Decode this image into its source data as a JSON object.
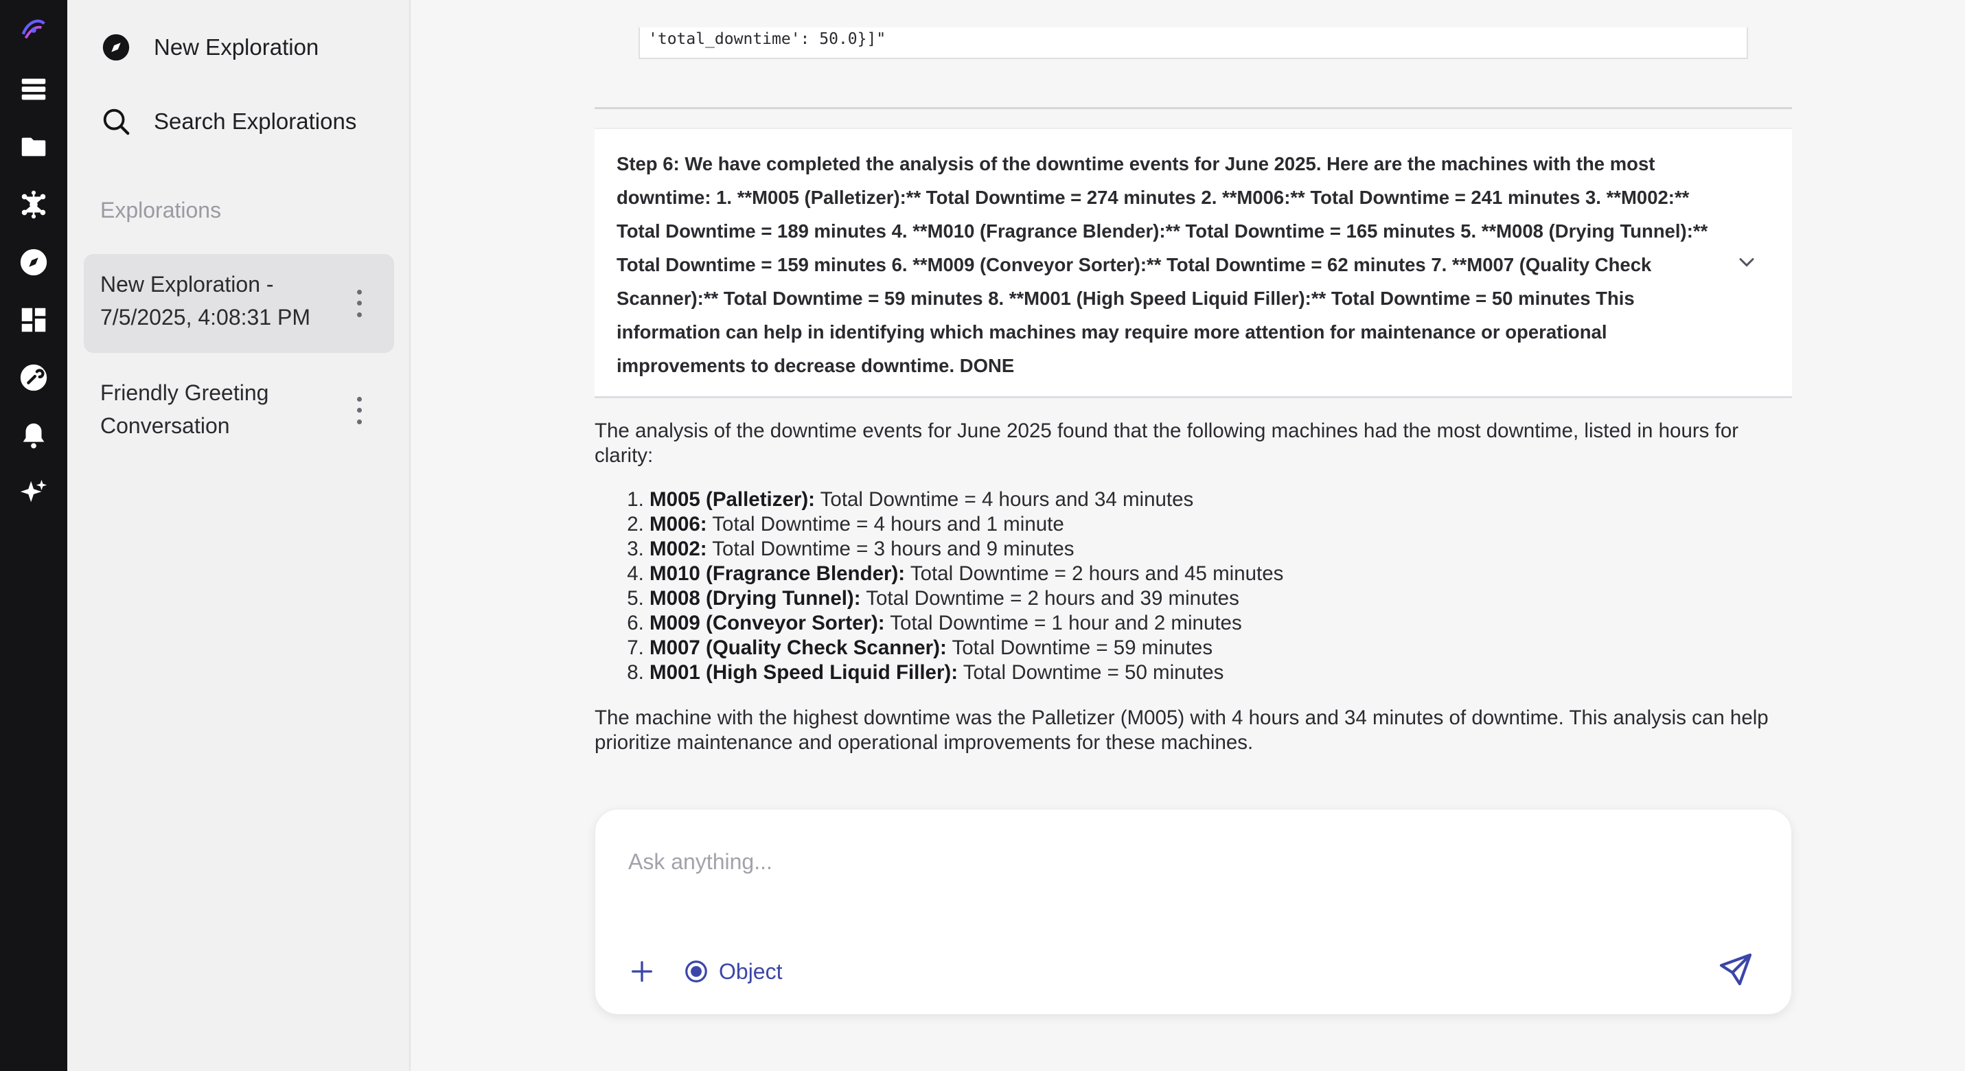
{
  "colors": {
    "rail_bg": "#141416",
    "sidebar_bg": "#f1f1f2",
    "main_bg": "#f6f6f7",
    "accent": "#3b46a8"
  },
  "rail": {
    "icons": [
      "logo-icon",
      "server-icon",
      "folder-icon",
      "network-icon",
      "compass-icon",
      "dashboard-icon",
      "wrench-icon",
      "bell-icon",
      "sparkle-icon"
    ]
  },
  "sidebar": {
    "new_exploration": "New Exploration",
    "search_explorations": "Search Explorations",
    "section_heading": "Explorations",
    "items": [
      {
        "title": "New Exploration - 7/5/2025, 4:08:31 PM",
        "active": true
      },
      {
        "title": "Friendly Greeting Conversation",
        "active": false
      }
    ]
  },
  "main": {
    "code_snippet": "'total_downtime': 50.0}]\"",
    "step_text": "Step 6: We have completed the analysis of the downtime events for June 2025. Here are the machines with the most downtime: 1. **M005 (Palletizer):** Total Downtime = 274 minutes 2. **M006:** Total Downtime = 241 minutes 3. **M002:** Total Downtime = 189 minutes 4. **M010 (Fragrance Blender):** Total Downtime = 165 minutes 5. **M008 (Drying Tunnel):** Total Downtime = 159 minutes 6. **M009 (Conveyor Sorter):** Total Downtime = 62 minutes 7. **M007 (Quality Check Scanner):** Total Downtime = 59 minutes 8. **M001 (High Speed Liquid Filler):** Total Downtime = 50 minutes This information can help in identifying which machines may require more attention for maintenance or operational improvements to decrease downtime. DONE",
    "answer_intro": "The analysis of the downtime events for June 2025 found that the following machines had the most downtime, listed in hours for clarity:",
    "machines": [
      {
        "name": "M005 (Palletizer):",
        "detail": "Total Downtime = 4 hours and 34 minutes"
      },
      {
        "name": "M006:",
        "detail": "Total Downtime = 4 hours and 1 minute"
      },
      {
        "name": "M002:",
        "detail": "Total Downtime = 3 hours and 9 minutes"
      },
      {
        "name": "M010 (Fragrance Blender):",
        "detail": "Total Downtime = 2 hours and 45 minutes"
      },
      {
        "name": "M008 (Drying Tunnel):",
        "detail": "Total Downtime = 2 hours and 39 minutes"
      },
      {
        "name": "M009 (Conveyor Sorter):",
        "detail": "Total Downtime = 1 hour and 2 minutes"
      },
      {
        "name": "M007 (Quality Check Scanner):",
        "detail": "Total Downtime = 59 minutes"
      },
      {
        "name": "M001 (High Speed Liquid Filler):",
        "detail": "Total Downtime = 50 minutes"
      }
    ],
    "answer_outro": "The machine with the highest downtime was the Palletizer (M005) with 4 hours and 34 minutes of downtime. This analysis can help prioritize maintenance and operational improvements for these machines."
  },
  "composer": {
    "placeholder": "Ask anything...",
    "value": "",
    "object_label": "Object"
  }
}
